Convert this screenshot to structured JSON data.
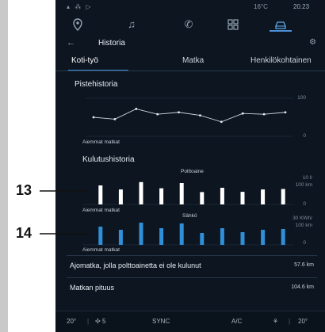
{
  "status": {
    "left": "▴ ⁂ ▷",
    "temp": "16°C",
    "clock": "20.23"
  },
  "nav_icons": [
    "location-pin-icon",
    "music-icon",
    "phone-icon",
    "apps-grid-icon",
    "car-icon"
  ],
  "header": {
    "back": "←",
    "title": "Historia",
    "settings": "⚙"
  },
  "tabs": [
    {
      "label": "Koti-työ",
      "active": true
    },
    {
      "label": "Matka",
      "active": false
    },
    {
      "label": "Henkilökohtainen",
      "active": false
    }
  ],
  "score_history": {
    "title": "Pistehistoria",
    "xlabel": "Aiemmat matkat",
    "ymax_label": "100",
    "ymin_label": "0"
  },
  "consumption": {
    "title": "Kulutushistoria",
    "fuel": {
      "label": "Polttoaine",
      "unit_top": "10 l/",
      "unit_bottom": "100 km",
      "zero": "0",
      "xlabel": "Aiemmat matkat"
    },
    "electric": {
      "label": "Sähkö",
      "unit_top": "30 KWh/",
      "unit_bottom": "100 km",
      "zero": "0",
      "xlabel": "Aiemmat matkat"
    }
  },
  "rows": [
    {
      "label": "Ajomatka, jolla polttoainetta ei ole kulunut",
      "value": "57.6 km"
    },
    {
      "label": "Matkan pituus",
      "value": "104.6 km"
    }
  ],
  "bottom_bar": {
    "left_temp": "20",
    "fan": "5",
    "sync": "SYNC",
    "ac": "A/C",
    "right_temp": "20"
  },
  "callouts": {
    "fuel": "13",
    "electric": "14"
  },
  "chart_data": [
    {
      "type": "line",
      "title": "Pistehistoria",
      "xlabel": "Aiemmat matkat",
      "ylim": [
        0,
        100
      ],
      "series": [
        {
          "values": [
            50,
            45,
            72,
            58,
            63,
            55,
            38,
            60,
            58,
            63
          ]
        }
      ]
    },
    {
      "type": "bar",
      "title": "Polttoaine",
      "xlabel": "Aiemmat matkat",
      "ylim": [
        0,
        10
      ],
      "values": [
        8.0,
        6.3,
        9.4,
        6.8,
        9.0,
        5.2,
        7.0,
        5.3,
        6.3,
        6.5
      ],
      "color": "#ffffff"
    },
    {
      "type": "bar",
      "title": "Sähkö",
      "xlabel": "Aiemmat matkat",
      "ylim": [
        0,
        30
      ],
      "values": [
        23,
        19,
        28,
        21,
        27,
        15,
        21,
        16,
        19,
        20
      ],
      "color": "#2f8fd8"
    }
  ]
}
